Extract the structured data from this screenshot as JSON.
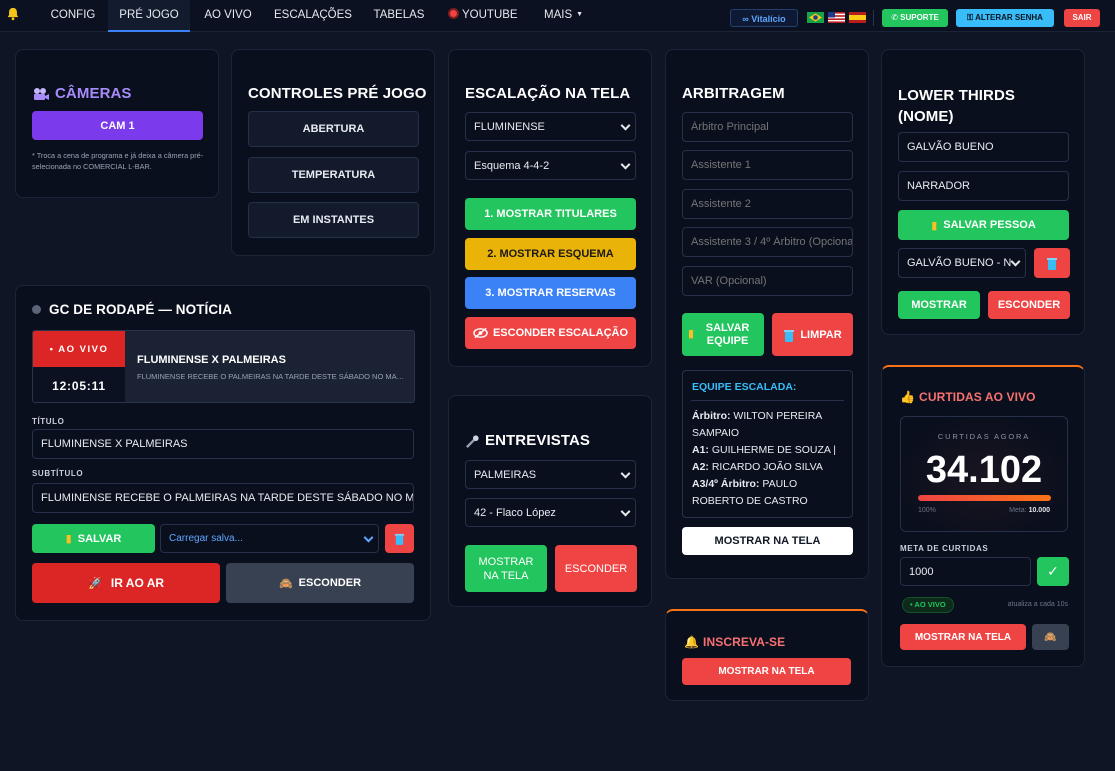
{
  "nav": {
    "items": [
      "CONFIG",
      "PRÉ JOGO",
      "AO VIVO",
      "ESCALAÇÕES",
      "TABELAS",
      "YOUTUBE",
      "MAIS"
    ],
    "vitalicio": "Vitalício",
    "suporte": "SUPORTE",
    "alterar_senha": "ALTERAR SENHA",
    "sair": "SAIR"
  },
  "cameras": {
    "title": "CÂMERAS",
    "cam_button": "CAM 1",
    "note": "* Troca a cena de programa e já deixa a câmera pré-selecionada no COMERCIAL L-BAR."
  },
  "controles": {
    "title": "CONTROLES PRÉ JOGO",
    "buttons": [
      "ABERTURA",
      "TEMPERATURA",
      "EM INSTANTES"
    ]
  },
  "escalacao": {
    "title": "ESCALAÇÃO NA TELA",
    "team_select": "FLUMINENSE",
    "scheme_select": "Esquema 4-4-2",
    "btn_titulares": "1. MOSTRAR TITULARES",
    "btn_esquema": "2. MOSTRAR ESQUEMA",
    "btn_reservas": "3. MOSTRAR RESERVAS",
    "btn_esconder": "ESCONDER ESCALAÇÃO"
  },
  "arbitragem": {
    "title": "ARBITRAGEM",
    "placeholders": [
      "Árbitro Principal",
      "Assistente 1",
      "Assistente 2",
      "Assistente 3 / 4º Árbitro (Opcional)",
      "VAR (Opcional)"
    ],
    "btn_salvar": "SALVAR EQUIPE",
    "btn_limpar": "LIMPAR",
    "equipe_title": "EQUIPE ESCALADA:",
    "equipe": [
      {
        "role": "Árbitro:",
        "name": "WILTON PEREIRA SAMPAIO"
      },
      {
        "role": "A1:",
        "name": "GUILHERME DE SOUZA |"
      },
      {
        "role": "A2:",
        "name": "RICARDO JOÃO SILVA"
      },
      {
        "role": "A3/4º Árbitro:",
        "name": "PAULO ROBERTO DE CASTRO"
      }
    ],
    "btn_mostrar": "MOSTRAR NA TELA"
  },
  "lower_thirds": {
    "title": "LOWER THIRDS (NOME)",
    "name_value": "GALVÃO BUENO",
    "role_value": "NARRADOR",
    "btn_salvar": "SALVAR PESSOA",
    "select_value": "GALVÃO BUENO - N",
    "btn_mostrar": "MOSTRAR",
    "btn_esconder": "ESCONDER"
  },
  "gc": {
    "title": "GC DE RODAPÉ — NOTÍCIA",
    "live_badge": "• AO VIVO",
    "time": "12:05:11",
    "preview_title": "FLUMINENSE X PALMEIRAS",
    "preview_subtitle": "FLUMINENSE RECEBE O PALMEIRAS NA TARDE DESTE SÁBADO NO MARACANÃ",
    "label_titulo": "TÍTULO",
    "titulo_value": "FLUMINENSE X PALMEIRAS",
    "label_subtitulo": "SUBTÍTULO",
    "subtitulo_value": "FLUMINENSE RECEBE O PALMEIRAS NA TARDE DESTE SÁBADO NO MARACANÃ",
    "btn_salvar": "SALVAR",
    "load_placeholder": "Carregar salva...",
    "btn_ir_ao_ar": "IR AO AR",
    "btn_esconder": "ESCONDER"
  },
  "entrevistas": {
    "title": "ENTREVISTAS",
    "team_select": "PALMEIRAS",
    "player_select": "42 - Flaco López",
    "btn_mostrar": "MOSTRAR NA TELA",
    "btn_esconder": "ESCONDER"
  },
  "curtidas": {
    "title": "CURTIDAS AO VIVO",
    "label": "CURTIDAS AGORA",
    "count": "34.102",
    "progress_percent": 100,
    "pct_label": "100%",
    "meta_label": "Meta:",
    "meta_value": "10.000",
    "meta_section": "META DE CURTIDAS",
    "meta_input": "1000",
    "status": "• AO VIVO",
    "update_note": "atualiza a cada 10s",
    "btn_mostrar": "MOSTRAR NA TELA"
  },
  "inscreva": {
    "title": "INSCREVA-SE",
    "btn_mostrar": "MOSTRAR NA TELA"
  },
  "colors": {
    "purple": "#7c3aed",
    "green": "#22c55e",
    "yellow": "#eab308",
    "blue": "#3b82f6",
    "red": "#ef4444",
    "accent_orange": "#f97316"
  }
}
